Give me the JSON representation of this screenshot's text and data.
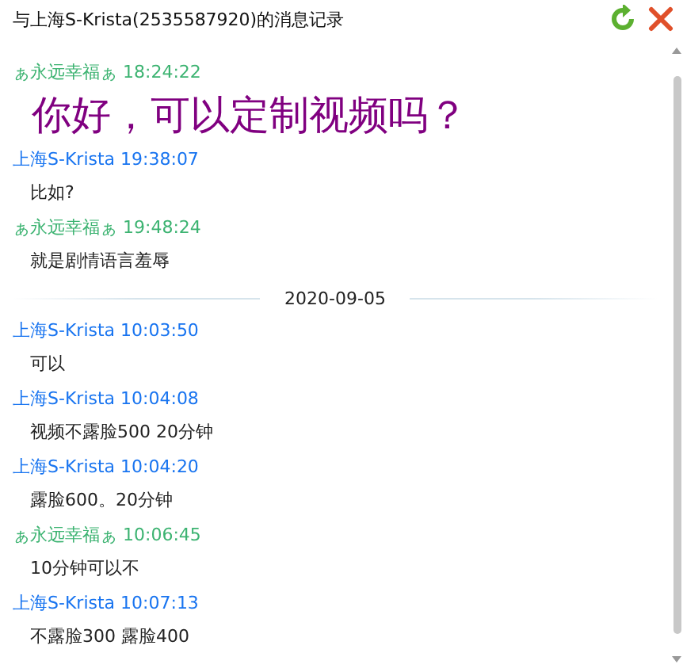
{
  "window": {
    "title": "与上海S-Krista(2535587920)的消息记录"
  },
  "entries": [
    {
      "kind": "message",
      "sender": "ぁ永远幸福ぁ",
      "time": "18:24:22",
      "color": "#3cb371",
      "text": "你好，可以定制视频吗？",
      "emphasis": true
    },
    {
      "kind": "message",
      "sender": "上海S-Krista",
      "time": "19:38:07",
      "color": "#1874f0",
      "text": "比如?",
      "emphasis": false
    },
    {
      "kind": "message",
      "sender": "ぁ永远幸福ぁ",
      "time": "19:48:24",
      "color": "#3cb371",
      "text": "就是剧情语言羞辱",
      "emphasis": false
    },
    {
      "kind": "date",
      "text": "2020-09-05"
    },
    {
      "kind": "message",
      "sender": "上海S-Krista",
      "time": "10:03:50",
      "color": "#1874f0",
      "text": "可以",
      "emphasis": false
    },
    {
      "kind": "message",
      "sender": "上海S-Krista",
      "time": "10:04:08",
      "color": "#1874f0",
      "text": "视频不露脸500 20分钟",
      "emphasis": false
    },
    {
      "kind": "message",
      "sender": "上海S-Krista",
      "time": "10:04:20",
      "color": "#1874f0",
      "text": "露脸600。20分钟",
      "emphasis": false
    },
    {
      "kind": "message",
      "sender": "ぁ永远幸福ぁ",
      "time": "10:06:45",
      "color": "#3cb371",
      "text": "10分钟可以不",
      "emphasis": false
    },
    {
      "kind": "message",
      "sender": "上海S-Krista",
      "time": "10:07:13",
      "color": "#1874f0",
      "text": "不露脸300 露脸400",
      "emphasis": false
    }
  ]
}
